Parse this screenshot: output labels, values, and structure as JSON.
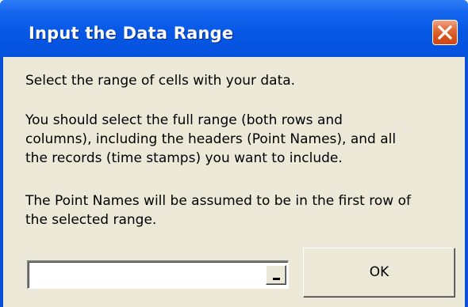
{
  "dialog": {
    "title": "Input the Data Range",
    "instruction": "Select the range of cells with your data.",
    "paragraph_selection": "You should select the full range (both rows and\ncolumns), including the headers (Point Names), and all\nthe records (time stamps) you want to include.",
    "paragraph_point_names": "The Point Names will be assumed to be in the first row of\nthe selected range.",
    "range_input": {
      "value": "",
      "placeholder": ""
    },
    "collapse_button_icon": "collapse-dialog-icon",
    "ok_label": "OK",
    "close_icon": "close-icon"
  },
  "colors": {
    "titlebar": "#0758e6",
    "dialog_face": "#ece9d8",
    "close_button": "#d4521c"
  }
}
